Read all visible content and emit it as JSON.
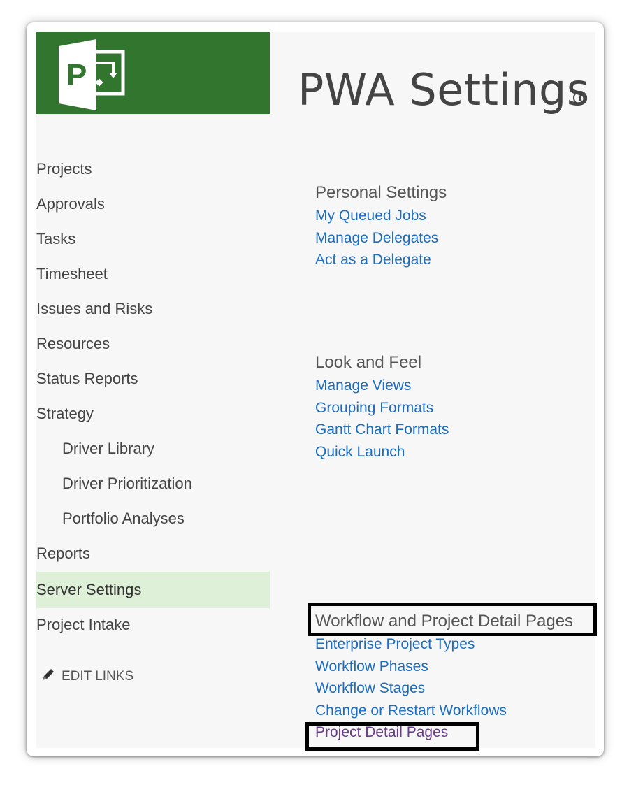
{
  "header": {
    "title": "PWA Settings",
    "logo_letter": "P",
    "brand_color": "#31752f",
    "info_icon": "info-circle-icon"
  },
  "nav": {
    "items": [
      {
        "label": "Projects"
      },
      {
        "label": "Approvals"
      },
      {
        "label": "Tasks"
      },
      {
        "label": "Timesheet"
      },
      {
        "label": "Issues and Risks"
      },
      {
        "label": "Resources"
      },
      {
        "label": "Status Reports"
      },
      {
        "label": "Strategy"
      },
      {
        "label": "Driver Library"
      },
      {
        "label": "Driver Prioritization"
      },
      {
        "label": "Portfolio Analyses"
      },
      {
        "label": "Reports"
      },
      {
        "label": "Server Settings",
        "selected": true
      },
      {
        "label": "Project Intake"
      }
    ],
    "edit_links_label": "EDIT LINKS",
    "selected_bg": "#dff0d8"
  },
  "sections": {
    "personal": {
      "title": "Personal Settings",
      "links": [
        "My Queued Jobs",
        "Manage Delegates",
        "Act as a Delegate"
      ]
    },
    "look_and_feel": {
      "title": "Look and Feel",
      "links": [
        "Manage Views",
        "Grouping Formats",
        "Gantt Chart Formats",
        "Quick Launch"
      ]
    },
    "workflow": {
      "title": "Workflow and Project Detail Pages",
      "links": [
        "Enterprise Project Types",
        "Workflow Phases",
        "Workflow Stages",
        "Change or Restart Workflows",
        "Project Detail Pages"
      ]
    }
  },
  "colors": {
    "link": "#1c6cbf",
    "visited_link": "#6b3a8e",
    "highlight_box": "#000000"
  }
}
